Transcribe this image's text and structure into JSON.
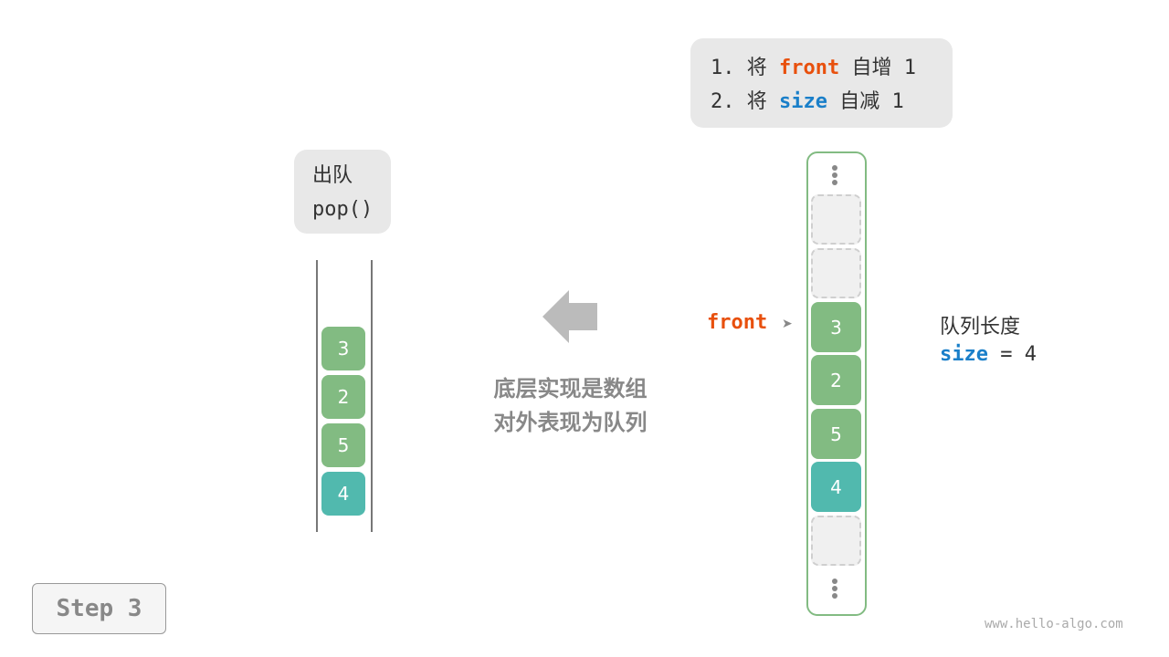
{
  "operation_note": {
    "line1": {
      "prefix": "1. 将 ",
      "keyword": "front",
      "suffix": " 自增 1"
    },
    "line2": {
      "prefix": "2. 将 ",
      "keyword": "size",
      "suffix": " 自减 1"
    }
  },
  "pop_label": {
    "title": "出队",
    "method": "pop()"
  },
  "left_queue": {
    "items": [
      {
        "value": "3",
        "color": "green"
      },
      {
        "value": "2",
        "color": "green"
      },
      {
        "value": "5",
        "color": "green"
      },
      {
        "value": "4",
        "color": "teal"
      }
    ]
  },
  "caption": {
    "line1": "底层实现是数组",
    "line2": "对外表现为队列"
  },
  "arrow_icon": "left-arrow-icon",
  "array": {
    "cells": [
      {
        "value": "",
        "state": "empty"
      },
      {
        "value": "",
        "state": "empty"
      },
      {
        "value": "3",
        "state": "green"
      },
      {
        "value": "2",
        "state": "green"
      },
      {
        "value": "5",
        "state": "green"
      },
      {
        "value": "4",
        "state": "teal"
      },
      {
        "value": "",
        "state": "empty"
      }
    ],
    "front_label": "front",
    "front_pointer": "➤",
    "front_index": 2
  },
  "length_info": {
    "title": "队列长度",
    "keyword": "size",
    "rest": " = 4"
  },
  "step": {
    "label": "Step 3"
  },
  "watermark": "www.hello-algo.com",
  "colors": {
    "front": "#e8500d",
    "size": "#1a7fc9",
    "green": "#82bb82",
    "teal": "#51b9ae",
    "empty": "#f0f0f0"
  }
}
